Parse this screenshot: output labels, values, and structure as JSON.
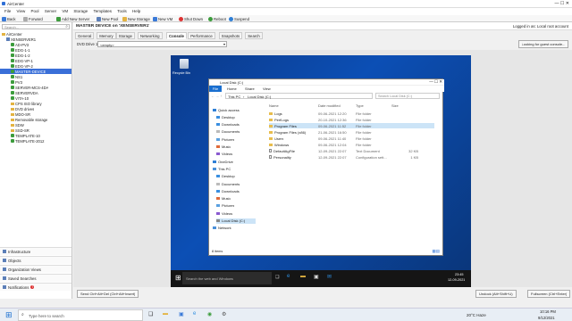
{
  "app": {
    "title": "AirCenter",
    "logged_in": "Logged in as: Local root account",
    "menu": [
      "File",
      "View",
      "Pool",
      "Server",
      "VM",
      "Storage",
      "Templates",
      "Tools",
      "Help"
    ],
    "toolbar": [
      "Back",
      "Forward",
      "Add New Server",
      "New Pool",
      "New Storage",
      "New VM",
      "Shut Down",
      "Reboot",
      "Suspend"
    ]
  },
  "left_panel": {
    "search_placeholder": "Search...",
    "tree": [
      {
        "label": "AirCenter",
        "kind": "folder",
        "indent": 0
      },
      {
        "label": "XENSERVER1",
        "kind": "host",
        "indent": 1
      },
      {
        "label": "AD-PV3",
        "kind": "vm",
        "indent": 2
      },
      {
        "label": "EDG-1-1",
        "kind": "vm",
        "indent": 2
      },
      {
        "label": "EDG-1-2",
        "kind": "vm",
        "indent": 2
      },
      {
        "label": "EDG-VP-1",
        "kind": "vm",
        "indent": 2
      },
      {
        "label": "EDG-VP-2",
        "kind": "vm",
        "indent": 2
      },
      {
        "label": "MASTER-DEVICE",
        "kind": "vm",
        "indent": 2,
        "selected": true
      },
      {
        "label": "NS1",
        "kind": "vm",
        "indent": 2
      },
      {
        "label": "PV3",
        "kind": "vm",
        "indent": 2
      },
      {
        "label": "SERVER-MCS-4DA",
        "kind": "vm",
        "indent": 2
      },
      {
        "label": "SERVERVDA",
        "kind": "vm",
        "indent": 2
      },
      {
        "label": "VITA-10",
        "kind": "vm",
        "indent": 2
      },
      {
        "label": "CPS ISO library",
        "kind": "folder",
        "indent": 2
      },
      {
        "label": "DVD drives",
        "kind": "folder",
        "indent": 2
      },
      {
        "label": "MDO-SR",
        "kind": "folder",
        "indent": 2
      },
      {
        "label": "Removable storage",
        "kind": "folder",
        "indent": 2
      },
      {
        "label": "SDW",
        "kind": "folder",
        "indent": 2
      },
      {
        "label": "SSD-SR",
        "kind": "folder",
        "indent": 2
      },
      {
        "label": "TEMPLATE-10",
        "kind": "vm",
        "indent": 2
      },
      {
        "label": "TEMPLATE-2012",
        "kind": "vm",
        "indent": 2
      }
    ],
    "panels": [
      {
        "label": "Infrastructure"
      },
      {
        "label": "Objects"
      },
      {
        "label": "Organization Views"
      },
      {
        "label": "Saved Searches"
      },
      {
        "label": "Notifications",
        "badge": "7"
      }
    ]
  },
  "main": {
    "header": "MASTER DEVICE on 'XENSERVER1'",
    "tabs": [
      "General",
      "Memory",
      "Storage",
      "Networking",
      "Console",
      "Performance",
      "Snapshots",
      "Search"
    ],
    "active_tab": "Console",
    "dvd_label": "DVD Drive 1:",
    "dvd_value": "<empty>",
    "console_search": "Looking for guest console...",
    "send_cad": "Send Ctrl+Alt+Del (Ctrl+Alt+Insert)",
    "undock": "Undock (Alt+Shift+U)",
    "fullscreen": "Fullscreen (Ctrl+Enter)"
  },
  "vm": {
    "recycle_bin": "Recycle Bin",
    "explorer": {
      "title": "Local Disk (C:)",
      "ribbon": [
        "File",
        "Home",
        "Share",
        "View"
      ],
      "path": [
        "This PC",
        "Local Disk (C:)"
      ],
      "search": "Search Local Disk (C:)",
      "columns": [
        "Name",
        "Date modified",
        "Type",
        "Size"
      ],
      "nav": [
        {
          "label": "Quick access",
          "color": "#2f7fd6"
        },
        {
          "label": "Desktop",
          "color": "#3a8fe0"
        },
        {
          "label": "Downloads",
          "color": "#3a8fe0"
        },
        {
          "label": "Documents",
          "color": "#bbb"
        },
        {
          "label": "Pictures",
          "color": "#5aa0e0"
        },
        {
          "label": "Music",
          "color": "#e06a3a"
        },
        {
          "label": "Videos",
          "color": "#8a5ad0"
        },
        {
          "label": "OneDrive",
          "color": "#2f7fd6"
        },
        {
          "label": "This PC",
          "color": "#4a90d9"
        },
        {
          "label": "Desktop",
          "color": "#3a8fe0"
        },
        {
          "label": "Documents",
          "color": "#bbb"
        },
        {
          "label": "Downloads",
          "color": "#3a8fe0"
        },
        {
          "label": "Music",
          "color": "#e06a3a"
        },
        {
          "label": "Pictures",
          "color": "#5aa0e0"
        },
        {
          "label": "Videos",
          "color": "#8a5ad0"
        },
        {
          "label": "Local Disk (C:)",
          "color": "#888"
        },
        {
          "label": "Network",
          "color": "#4a90d9"
        }
      ],
      "rows": [
        {
          "name": "Logs",
          "date": "09-06-2021 12:20",
          "type": "File folder",
          "size": ""
        },
        {
          "name": "PerfLogs",
          "date": "20-10-2021 12:36",
          "type": "File folder",
          "size": ""
        },
        {
          "name": "Program Files",
          "date": "09-06-2021 11:52",
          "type": "File folder",
          "size": ""
        },
        {
          "name": "Program Files (x86)",
          "date": "21-06-2021 16:50",
          "type": "File folder",
          "size": ""
        },
        {
          "name": "Users",
          "date": "09-06-2021 11:40",
          "type": "File folder",
          "size": ""
        },
        {
          "name": "Windows",
          "date": "09-06-2021 12:04",
          "type": "File folder",
          "size": ""
        },
        {
          "name": "DefaultAgFile",
          "date": "12-09-2021 22:07",
          "type": "Text Document",
          "size": "32 KB"
        },
        {
          "name": "Personality",
          "date": "12-09-2021 22:07",
          "type": "Configuration sett...",
          "size": "1 KB"
        }
      ],
      "status": "8 items"
    },
    "taskbar_search": "Search the web and Windows",
    "clock": "23:45",
    "date": "12-09-2021"
  },
  "host_taskbar": {
    "search": "Type here to search",
    "weather": "20°C  Haze",
    "clock": "10:16 PM",
    "date": "9/12/2021"
  }
}
